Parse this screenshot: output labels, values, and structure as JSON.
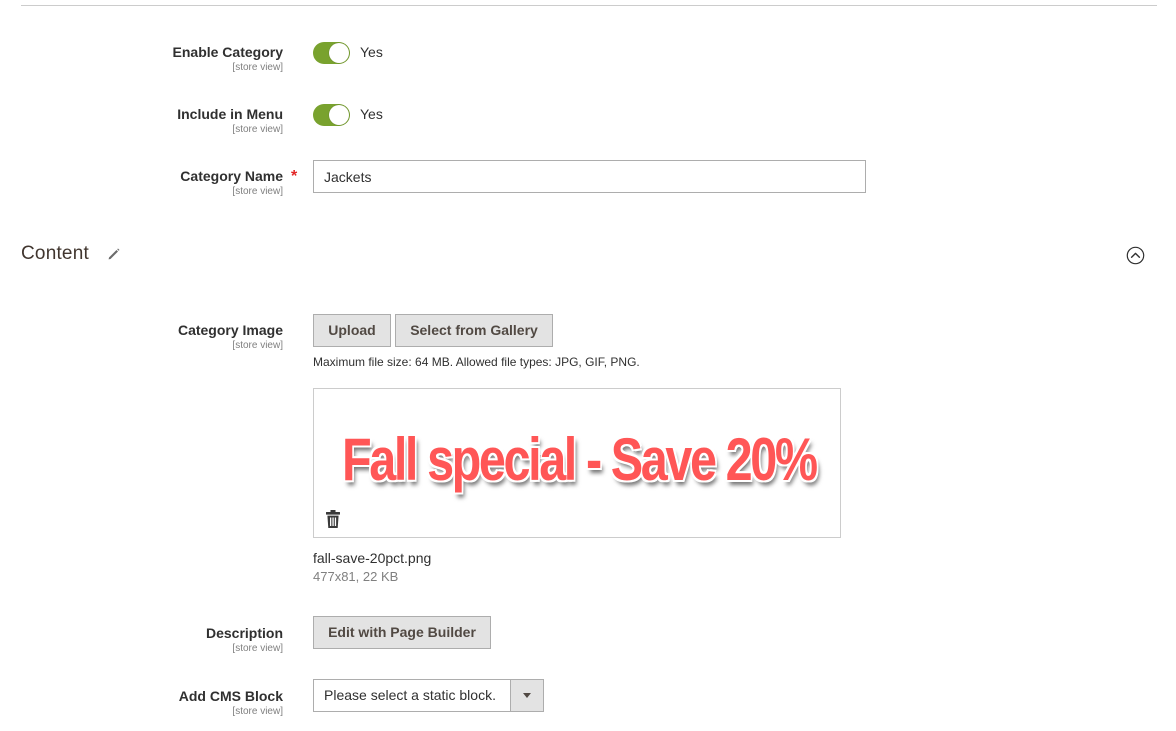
{
  "general": {
    "enable_category": {
      "label": "Enable Category",
      "scope": "[store view]",
      "value": "Yes",
      "checked": true
    },
    "include_in_menu": {
      "label": "Include in Menu",
      "scope": "[store view]",
      "value": "Yes",
      "checked": true
    },
    "category_name": {
      "label": "Category Name",
      "scope": "[store view]",
      "required_mark": "*",
      "value": "Jackets"
    }
  },
  "content_section": {
    "title": "Content",
    "edit_icon": "pencil-icon",
    "collapse_icon": "chevron-up-circle-icon",
    "category_image": {
      "label": "Category Image",
      "scope": "[store view]",
      "upload_label": "Upload",
      "gallery_label": "Select from Gallery",
      "note": "Maximum file size: 64 MB. Allowed file types: JPG, GIF, PNG.",
      "preview_text": "Fall special - Save 20%",
      "delete_icon": "trash-icon",
      "file_name": "fall-save-20pct.png",
      "file_meta": "477x81, 22 KB"
    },
    "description": {
      "label": "Description",
      "scope": "[store view]",
      "button_label": "Edit with Page Builder"
    },
    "cms_block": {
      "label": "Add CMS Block",
      "scope": "[store view]",
      "selected": "Please select a static block."
    }
  },
  "colors": {
    "toggle_on": "#79a22e",
    "required": "#e22626",
    "banner_text": "#ff5656",
    "button_bg": "#e3e3e3"
  }
}
